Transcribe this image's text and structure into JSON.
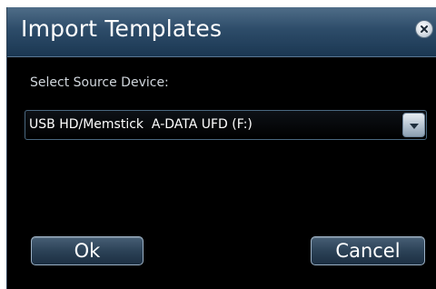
{
  "dialog": {
    "title": "Import Templates",
    "close_icon": "close-icon",
    "source_label": "Select Source Device:",
    "source_select": {
      "value": "USB HD/Memstick  A-DATA UFD (F:)",
      "arrow_icon": "chevron-down-icon"
    },
    "buttons": {
      "ok_label": "Ok",
      "cancel_label": "Cancel"
    }
  },
  "colors": {
    "title_bar": "#2d4c69",
    "background": "#000000",
    "button_border": "#9bb0c4",
    "text": "#ffffff"
  }
}
